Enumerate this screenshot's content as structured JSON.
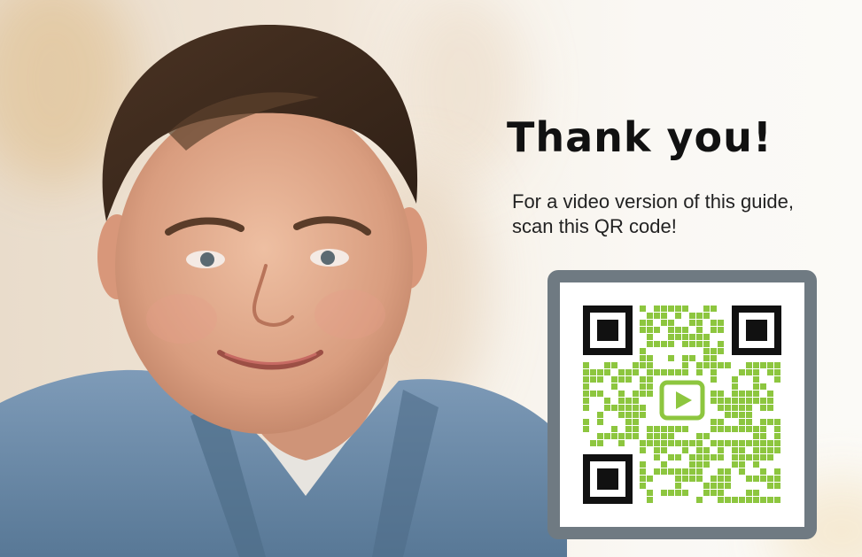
{
  "title": "Thank you!",
  "subtitle": "For a video version of this guide, scan this QR code!",
  "colors": {
    "qr_frame": "#6f7a82",
    "qr_modules": "#8dc63f",
    "finder": "#111111",
    "shirt": "#6f8fae"
  },
  "icons": {
    "qr_center": "play-icon"
  }
}
